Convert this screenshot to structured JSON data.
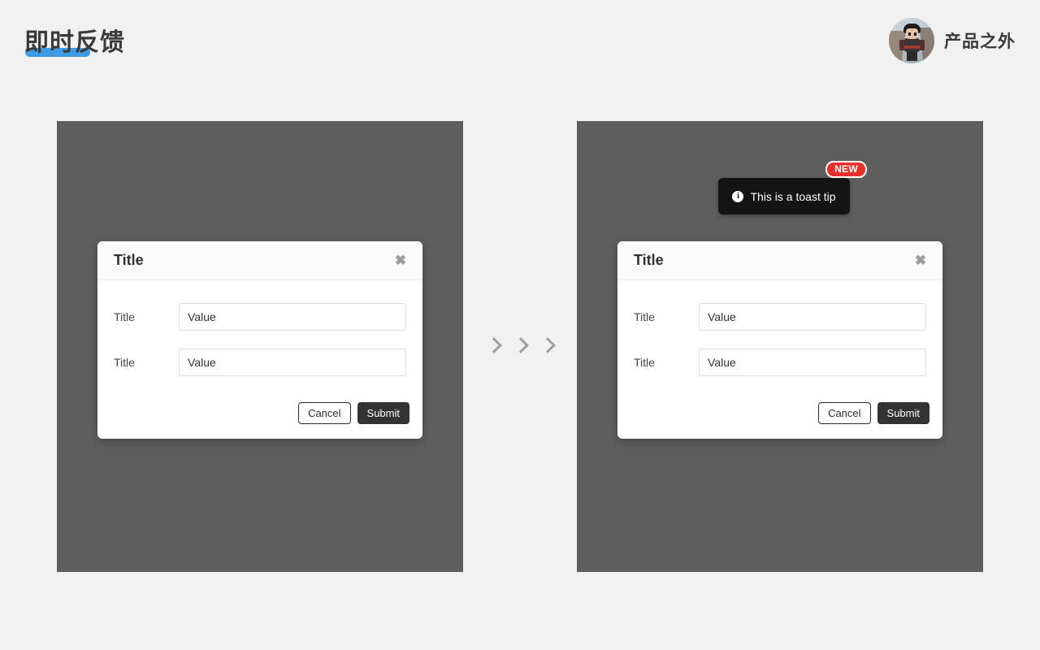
{
  "header": {
    "page_title": "即时反馈",
    "underline_color": "#3d9ae3",
    "brand_name": "产品之外",
    "avatar_icon": "avatar-pixel-character"
  },
  "flow": {
    "arrow_icon": "chevron-right-icon",
    "arrow_count": 3,
    "arrow_color": "#9e9e9e"
  },
  "panels": [
    {
      "id": "before",
      "background": "#5e5e5e",
      "modal": {
        "title": "Title",
        "close_icon": "close-icon",
        "close_glyph": "✖",
        "fields": [
          {
            "label": "Title",
            "value": "Value"
          },
          {
            "label": "Title",
            "value": "Value"
          }
        ],
        "cancel_label": "Cancel",
        "submit_label": "Submit"
      },
      "toast": null
    },
    {
      "id": "after",
      "background": "#5e5e5e",
      "modal": {
        "title": "Title",
        "close_icon": "close-icon",
        "close_glyph": "✖",
        "fields": [
          {
            "label": "Title",
            "value": "Value"
          },
          {
            "label": "Title",
            "value": "Value"
          }
        ],
        "cancel_label": "Cancel",
        "submit_label": "Submit"
      },
      "toast": {
        "icon": "info-circle-icon",
        "icon_glyph": "i",
        "message": "This is a toast tip",
        "badge_label": "NEW",
        "badge_color": "#e8302a",
        "background": "#141414"
      }
    }
  ]
}
